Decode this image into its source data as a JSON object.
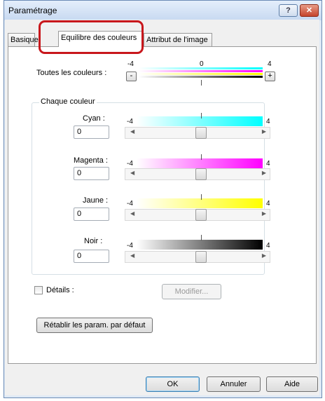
{
  "window": {
    "title": "Paramétrage"
  },
  "tabs": [
    "Basique",
    "Equilibre des couleurs",
    "Attribut de l'image"
  ],
  "all_colors": {
    "label": "Toutes les couleurs :",
    "scale_min": "-4",
    "scale_mid": "0",
    "scale_max": "4",
    "minus": "-",
    "plus": "+"
  },
  "each_color": {
    "title": "Chaque couleur",
    "channels": [
      {
        "label": "Cyan :",
        "value": "0",
        "min": "-4",
        "max": "4",
        "color": "#00ffff"
      },
      {
        "label": "Magenta :",
        "value": "0",
        "min": "-4",
        "max": "4",
        "color": "#ff00ff"
      },
      {
        "label": "Jaune :",
        "value": "0",
        "min": "-4",
        "max": "4",
        "color": "#ffff00"
      },
      {
        "label": "Noir :",
        "value": "0",
        "min": "-4",
        "max": "4",
        "color": "#000000"
      }
    ]
  },
  "details": {
    "label": "Détails :",
    "checked": false,
    "modify_button": "Modifier..."
  },
  "reset_button": "Rétablir les param. par défaut",
  "footer": {
    "ok": "OK",
    "cancel": "Annuler",
    "help": "Aide"
  },
  "titlebar": {
    "help": "?",
    "close": "✕"
  },
  "scroll_arrows": {
    "left": "◀",
    "right": "▶"
  }
}
